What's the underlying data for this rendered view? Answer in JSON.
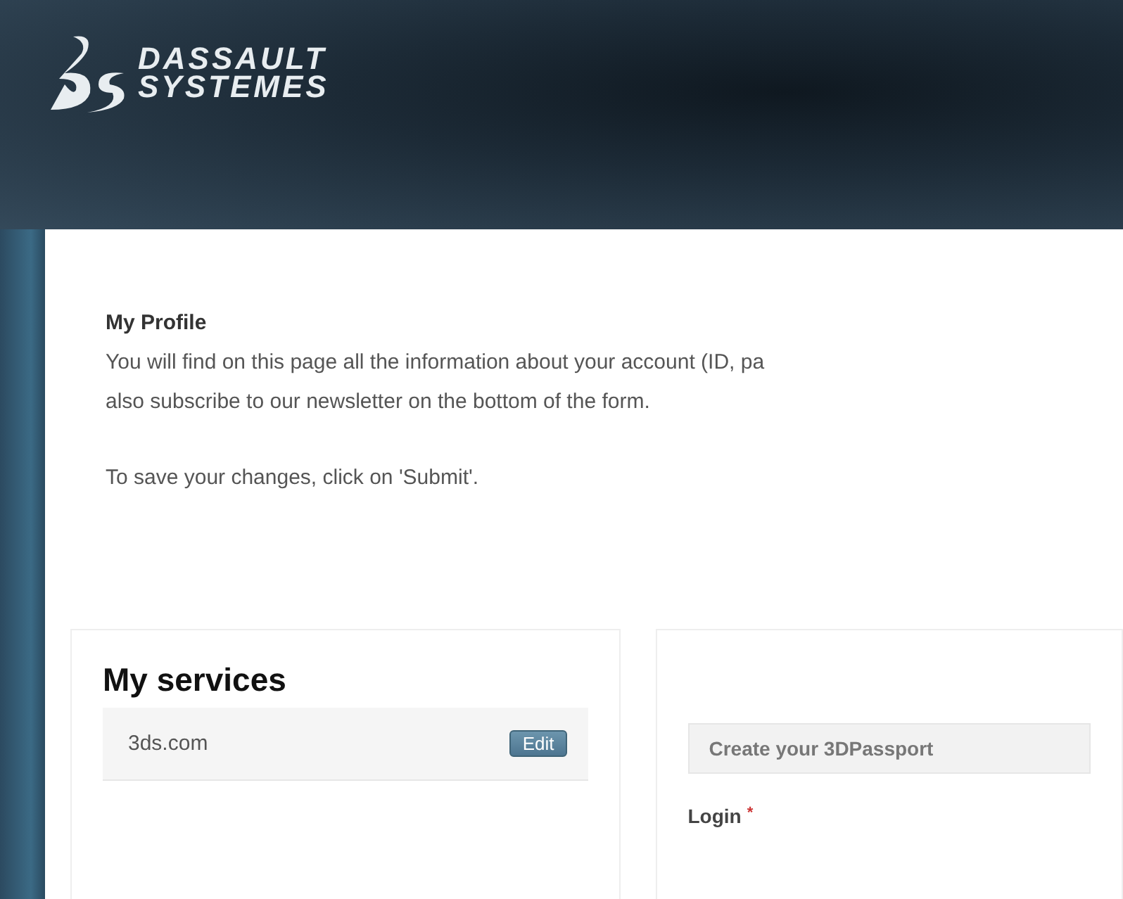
{
  "header": {
    "logo_line_1": "DASSAULT",
    "logo_line_2": "SYSTEMES"
  },
  "intro": {
    "title": "My Profile",
    "text": "You will find on this page all the information about your account (ID, pa",
    "text_2": "also subscribe to our newsletter on the bottom of the form.",
    "note": "To save your changes, click on 'Submit'."
  },
  "services": {
    "title": "My services",
    "items": [
      {
        "name": "3ds.com",
        "action": "Edit"
      }
    ]
  },
  "passport": {
    "section": "Create your 3DPassport",
    "fields": [
      {
        "label": "Login",
        "required": true,
        "required_mark": "*"
      }
    ]
  }
}
